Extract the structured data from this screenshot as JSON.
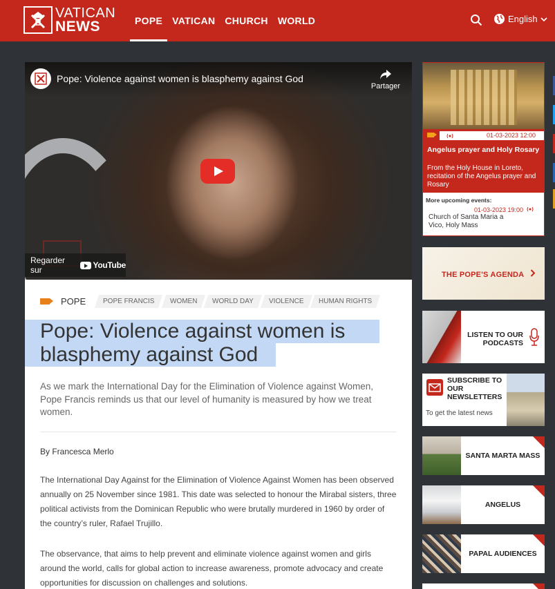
{
  "header": {
    "logo_line1": "VATICAN",
    "logo_line2": "NEWS",
    "nav": [
      {
        "label": "POPE",
        "active": true
      },
      {
        "label": "VATICAN",
        "active": false
      },
      {
        "label": "CHURCH",
        "active": false
      },
      {
        "label": "WORLD",
        "active": false
      }
    ],
    "language": "English",
    "icons": [
      "search-icon",
      "globe-icon",
      "chevron-down-icon"
    ]
  },
  "video": {
    "title": "Pope: Violence against women is blasphemy against God",
    "share_label": "Partager",
    "watch_on": "Regarder sur",
    "youtube_label": "YouTube"
  },
  "article": {
    "section": "POPE",
    "tags": [
      "POPE FRANCIS",
      "WOMEN",
      "WORLD DAY",
      "VIOLENCE",
      "HUMAN RIGHTS"
    ],
    "headline_line1": "Pope: Violence against women is",
    "headline_line2": "blasphemy against God",
    "lede": "As we mark the International Day for the Elimination of Violence against Women, Pope Francis reminds us that our level of humanity is measured by how we treat women.",
    "byline": "By Francesca Merlo",
    "paragraphs": [
      "The International Day Against for the Elimination of Violence Against Women has been observed annually on 25 November since 1981. This date was selected to honour the Mirabal sisters, three political activists from the Dominican Republic who were brutally murdered in 1960 by order of the country’s ruler, Rafael Trujillo.",
      "The observance, that aims to help prevent and eliminate violence against women and girls around the world, calls for global action to increase awareness, promote advocacy and create opportunities for discussion on challenges and solutions."
    ]
  },
  "sidebar": {
    "live": {
      "datetime": "01-03-2023 12:00",
      "title": "Angelus prayer and Holy Rosary",
      "description": "From the Holy House in Loreto, recitation of the Angelus prayer and Rosary",
      "more_label": "More upcoming events:",
      "next_datetime": "01-03-2023 19:00",
      "next_description": "Church of Santa Maria a Vico, Holy Mass"
    },
    "agenda_label": "THE POPE'S AGENDA",
    "podcasts_label": "LISTEN TO OUR PODCASTS",
    "newsletter_label": "SUBSCRIBE TO OUR NEWSLETTERS",
    "newsletter_sub": "To get the latest news",
    "mini_cards": [
      "SANTA MARTA MASS",
      "ANGELUS",
      "PAPAL AUDIENCES"
    ]
  },
  "colors": {
    "brand_red": "#c4271c",
    "page_bg": "#2f3338",
    "highlight": "#c3d8f5"
  }
}
